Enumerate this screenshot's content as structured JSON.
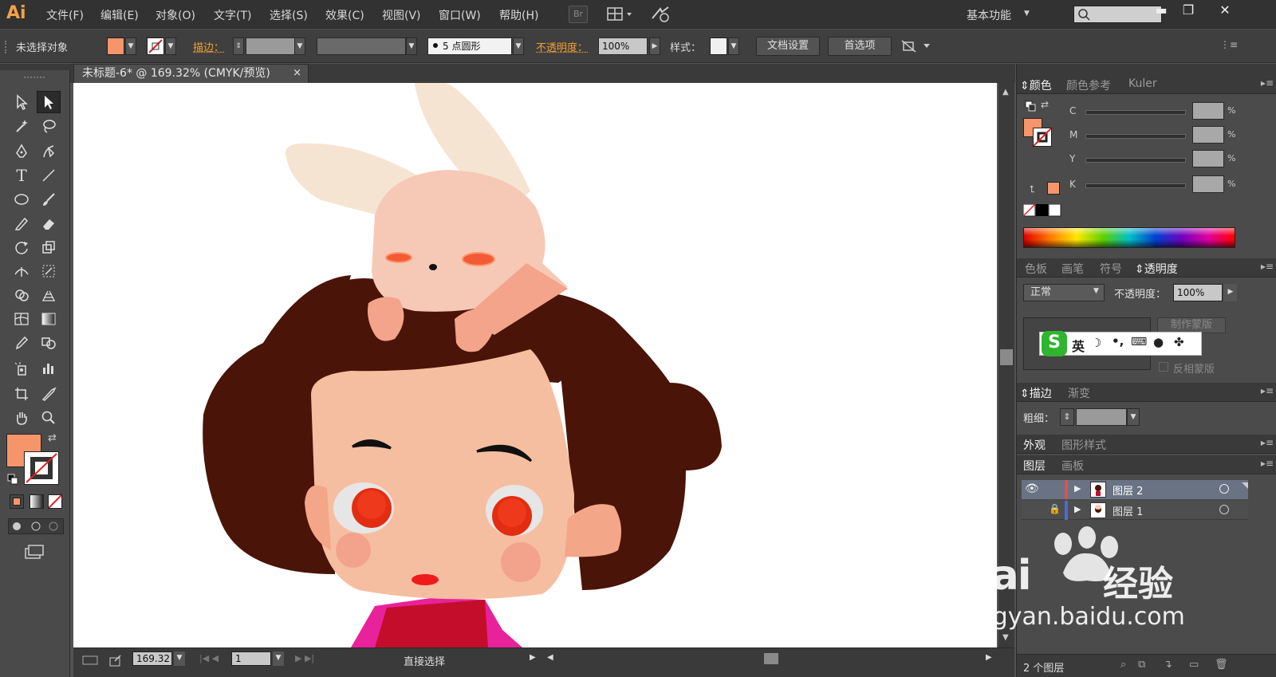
{
  "app": {
    "logo": "Ai"
  },
  "menu": [
    "文件(F)",
    "编辑(E)",
    "对象(O)",
    "文字(T)",
    "选择(S)",
    "效果(C)",
    "视图(V)",
    "窗口(W)",
    "帮助(H)"
  ],
  "bridge_label": "Br",
  "workspace": "基本功能",
  "control": {
    "selection_status": "未选择对象",
    "stroke_label": "描边：",
    "brush_label": "5 点圆形",
    "opacity_label": "不透明度：",
    "opacity_value": "100%",
    "style_label": "样式：",
    "doc_setup": "文档设置",
    "preferences": "首选项"
  },
  "document_tab": {
    "title": "未标题-6* @ 169.32% (CMYK/预览)",
    "close": "×"
  },
  "status": {
    "zoom": "169.32",
    "page": "1",
    "tool": "直接选择"
  },
  "color_panel": {
    "tabs": [
      "颜色",
      "颜色参考",
      "Kuler"
    ],
    "channels": [
      "C",
      "M",
      "Y",
      "K"
    ],
    "pct": "%"
  },
  "transparency_panel": {
    "tabs": [
      "色板",
      "画笔",
      "符号",
      "透明度"
    ],
    "blend_mode": "正常",
    "opacity_label": "不透明度：",
    "opacity_value": "100%",
    "make_mask": "制作蒙版",
    "invert_mask": "反相蒙版"
  },
  "ime": {
    "label": "英"
  },
  "stroke_panel": {
    "tabs": [
      "描边",
      "渐变"
    ],
    "weight_label": "粗细："
  },
  "appearance_panel": {
    "tabs": [
      "外观",
      "图形样式"
    ]
  },
  "layers_panel": {
    "tabs": [
      "图层",
      "画板"
    ],
    "layers": [
      {
        "name": "图层 2",
        "visible": true,
        "locked": false,
        "color": "#e05050"
      },
      {
        "name": "图层 1",
        "visible": false,
        "locked": true,
        "color": "#4a6adc"
      }
    ],
    "count": "2 个图层"
  },
  "watermark": {
    "brand": "Bai",
    "brand2": "经验",
    "url": "jingyan.baidu.com"
  },
  "colors": {
    "fill": "#f7956a",
    "accent": "#f0a030"
  }
}
